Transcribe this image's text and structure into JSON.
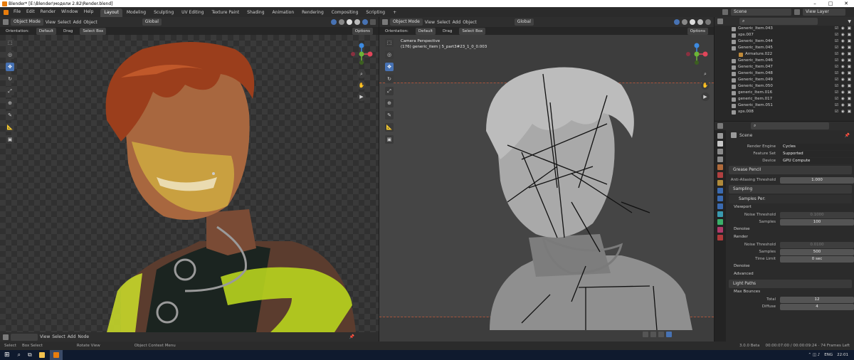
{
  "window": {
    "title": "Blender* [E:\\Blender\\модели 2.82\\Render.blend]"
  },
  "menubar": {
    "menus": [
      "File",
      "Edit",
      "Render",
      "Window",
      "Help"
    ],
    "workspaces": [
      "Layout",
      "Modeling",
      "Sculpting",
      "UV Editing",
      "Texture Paint",
      "Shading",
      "Animation",
      "Rendering",
      "Compositing",
      "Scripting"
    ],
    "add_tab": "+",
    "scene_label": "Scene",
    "viewlayer_label": "View Layer"
  },
  "left_viewport": {
    "mode": "Object Mode",
    "menus": [
      "View",
      "Select",
      "Add",
      "Object"
    ],
    "transform": "Global",
    "orientation_label": "Orientation:",
    "orientation_value": "Default",
    "drag_label": "Drag",
    "drag_value": "Select Box",
    "options": "Options"
  },
  "right_viewport": {
    "mode": "Object Mode",
    "menus": [
      "View",
      "Select",
      "Add",
      "Object"
    ],
    "transform": "Global",
    "orientation_label": "Orientation:",
    "orientation_value": "Default",
    "drag_label": "Drag",
    "drag_value": "Select Box",
    "options": "Options",
    "overlay_title": "Camera Perspective",
    "overlay_object": "(176) generic_item | 5_part3#23_1_0_0.003"
  },
  "bottom_editor": {
    "menus": [
      "View",
      "Select",
      "Add",
      "Node"
    ]
  },
  "outliner": {
    "items": [
      {
        "name": "Generic_Item.043",
        "indent": 1,
        "kind": "mesh"
      },
      {
        "name": "xps.007",
        "indent": 1,
        "kind": "mesh"
      },
      {
        "name": "Generic_Item.044",
        "indent": 1,
        "kind": "mesh"
      },
      {
        "name": "Generic_Item.045",
        "indent": 1,
        "kind": "mesh"
      },
      {
        "name": "Armature.022",
        "indent": 2,
        "kind": "armature"
      },
      {
        "name": "Generic_Item.046",
        "indent": 1,
        "kind": "mesh"
      },
      {
        "name": "Generic_Item.047",
        "indent": 1,
        "kind": "mesh"
      },
      {
        "name": "Generic_Item.048",
        "indent": 1,
        "kind": "mesh"
      },
      {
        "name": "Generic_Item.049",
        "indent": 1,
        "kind": "mesh"
      },
      {
        "name": "Generic_Item.050",
        "indent": 1,
        "kind": "mesh"
      },
      {
        "name": "generic_Item.016",
        "indent": 1,
        "kind": "mesh"
      },
      {
        "name": "generic_Item.017",
        "indent": 1,
        "kind": "mesh"
      },
      {
        "name": "Generic_Item.051",
        "indent": 1,
        "kind": "mesh"
      },
      {
        "name": "xps.008",
        "indent": 1,
        "kind": "mesh"
      }
    ]
  },
  "properties": {
    "context": "Scene",
    "render_engine_label": "Render Engine",
    "render_engine": "Cycles",
    "feature_set_label": "Feature Set",
    "feature_set": "Supported",
    "device_label": "Device",
    "device": "GPU Compute",
    "grease_pencil": "Grease Pencil",
    "aa_label": "Anti-Aliasing Threshold",
    "aa_value": "1.000",
    "sampling": "Sampling",
    "presets": "Samples Per:",
    "viewport": "Viewport",
    "noise_threshold_label": "Noise Threshold",
    "vp_noise_value": "0.1000",
    "samples_label": "Samples",
    "vp_samples": "100",
    "denoise": "Denoise",
    "render": "Render",
    "r_noise_value": "0.0100",
    "r_samples": "500",
    "time_limit_label": "Time Limit",
    "time_limit": "0 sec",
    "advanced": "Advanced",
    "light_paths": "Light Paths",
    "max_bounces": "Max Bounces",
    "total_label": "Total",
    "total": "12",
    "diffuse_label": "Diffuse",
    "diffuse": "4"
  },
  "statusbar": {
    "items": [
      "Select",
      "Box Select",
      "Rotate View",
      "Object Context Menu"
    ],
    "version": "3.0.0 Beta",
    "stats": "00:00:07:00 / 00:00:09:24 · 74 Frames Left"
  },
  "taskbar": {
    "lang": "ENG",
    "time": "22:01"
  },
  "colors": {
    "accent": "#4772b3",
    "active_tab": "#474747",
    "bg": "#1d1d1d"
  }
}
